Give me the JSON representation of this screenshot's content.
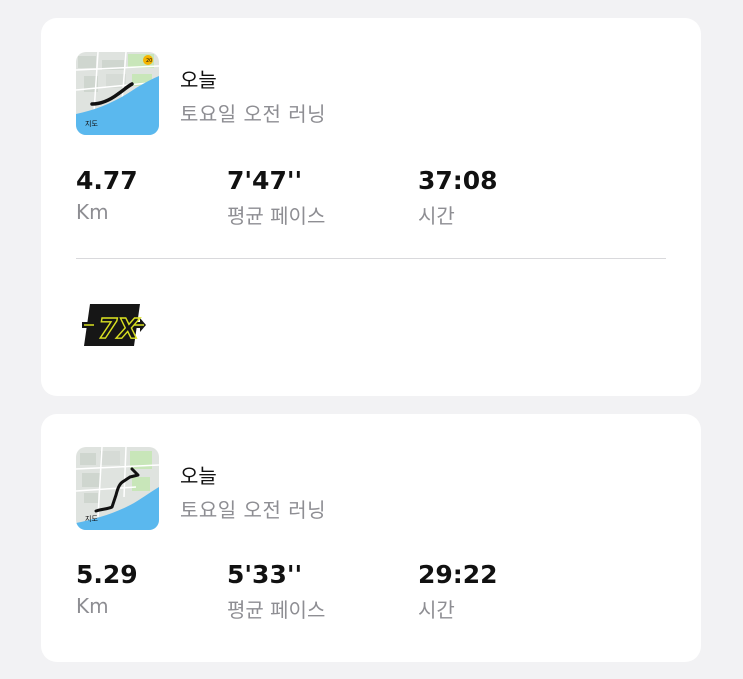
{
  "activities": [
    {
      "title": "오늘",
      "subtitle": "토요일 오전 러닝",
      "map_label": "지도",
      "stats": [
        {
          "value": "4.77",
          "label": "Km"
        },
        {
          "value": "7'47''",
          "label": "평균 페이스"
        },
        {
          "value": "37:08",
          "label": "시간"
        }
      ],
      "badge": {
        "text": "7X",
        "icon": "streak-badge-icon"
      }
    },
    {
      "title": "오늘",
      "subtitle": "토요일 오전 러닝",
      "map_label": "지도",
      "stats": [
        {
          "value": "5.29",
          "label": "Km"
        },
        {
          "value": "5'33''",
          "label": "평균 페이스"
        },
        {
          "value": "29:22",
          "label": "시간"
        }
      ]
    }
  ],
  "colors": {
    "background": "#f2f2f4",
    "card": "#ffffff",
    "secondary_text": "#8e8e93",
    "map_water": "#5ab8ee",
    "badge_yellow": "#d9e021"
  }
}
